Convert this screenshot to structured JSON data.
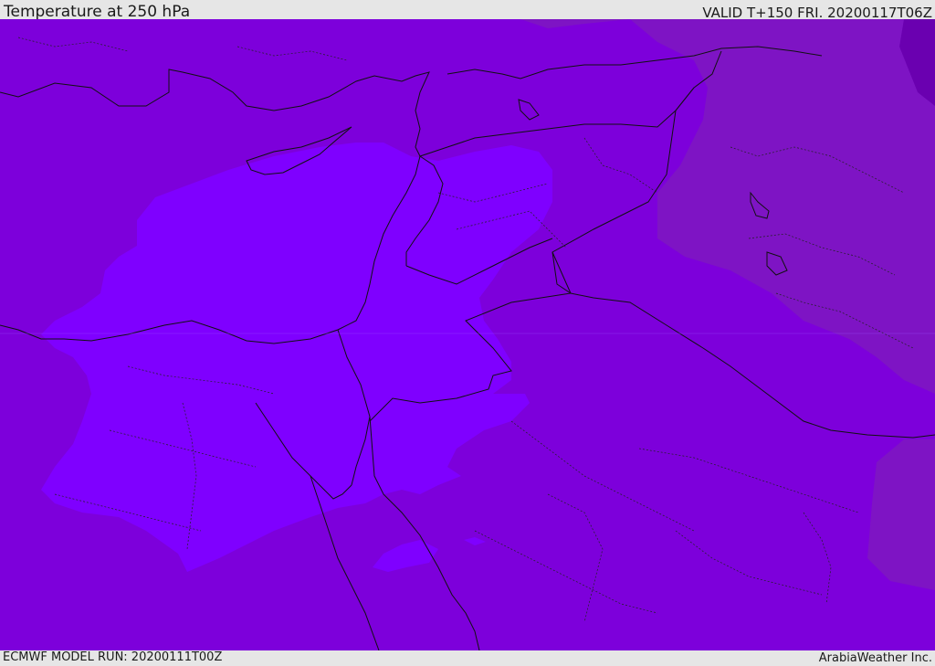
{
  "header": {
    "title": "Temperature at 250 hPa",
    "valid": "VALID T+150 FRI. 20200117T06Z"
  },
  "footer": {
    "model_run": "ECMWF MODEL RUN: 20200111T00Z",
    "credit": "ArabiaWeather Inc."
  },
  "map": {
    "region": "Eastern Mediterranean / Middle East",
    "colors": {
      "base": "#7d00db",
      "warm": "#7f00ff",
      "cool": "#7e14c4",
      "cooler": "#6a00b0",
      "border": "#111111"
    }
  }
}
